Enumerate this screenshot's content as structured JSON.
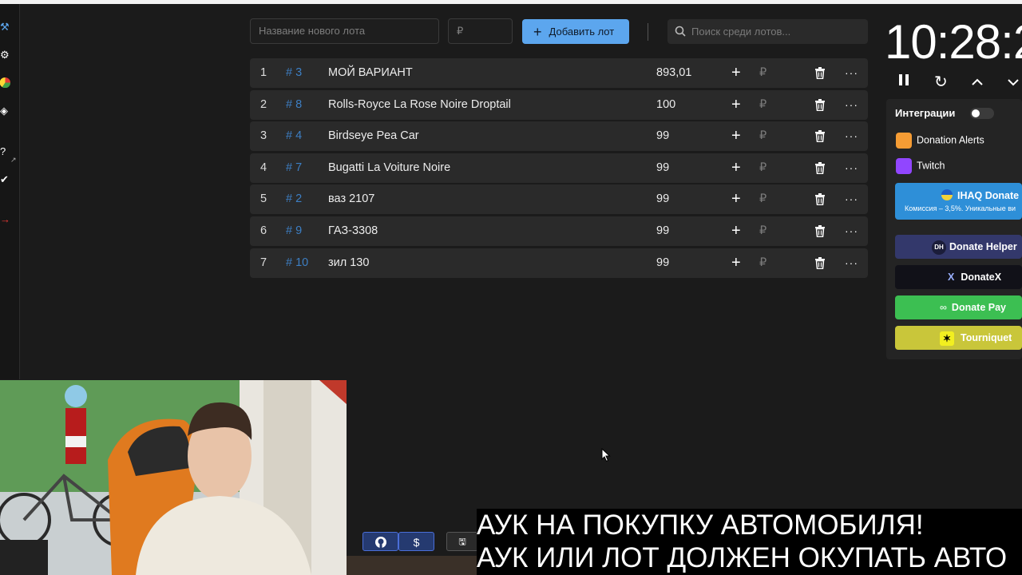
{
  "sidebar": {
    "icons": [
      "hammer-icon",
      "gear-icon",
      "pie-chart-icon",
      "layers-icon",
      "help-icon",
      "shield-check-icon",
      "logout-icon"
    ]
  },
  "toolbar": {
    "lot_name_placeholder": "Название нового лота",
    "amount_placeholder": "₽",
    "add_label": "Добавить лот",
    "search_placeholder": "Поиск среди лотов..."
  },
  "lots": [
    {
      "num": "1",
      "id": "# 3",
      "name": "МОЙ ВАРИАНТ",
      "amount": "893,01",
      "currency": "₽"
    },
    {
      "num": "2",
      "id": "# 8",
      "name": "Rolls-Royce La Rose Noire Droptail",
      "amount": "100",
      "currency": "₽"
    },
    {
      "num": "3",
      "id": "# 4",
      "name": "Birdseye Pea Car",
      "amount": "99",
      "currency": "₽"
    },
    {
      "num": "4",
      "id": "# 7",
      "name": "Bugatti La Voiture Noire",
      "amount": "99",
      "currency": "₽"
    },
    {
      "num": "5",
      "id": "# 2",
      "name": "ваз 2107",
      "amount": "99",
      "currency": "₽"
    },
    {
      "num": "6",
      "id": "# 9",
      "name": "ГАЗ-3308",
      "amount": "99",
      "currency": "₽"
    },
    {
      "num": "7",
      "id": "# 10",
      "name": "зил 130",
      "amount": "99",
      "currency": "₽"
    }
  ],
  "timer": {
    "display": "10:28:2"
  },
  "integrations": {
    "title": "Интеграции",
    "enabled": false,
    "items": [
      {
        "label": "Donation Alerts",
        "color": "#f59c34"
      },
      {
        "label": "Twitch",
        "color": "#9146ff"
      }
    ],
    "services": [
      {
        "label": "IHAQ Donate",
        "sub": "Комиссия – 3,5%. Уникальные ви",
        "color": "#2e8fd8"
      },
      {
        "label": "Donate Helper",
        "badge": "DH",
        "color": "#33386b"
      },
      {
        "label": "DonateX",
        "badge": "X",
        "color": "#111118"
      },
      {
        "label": "Donate Pay",
        "color": "#3cbf52"
      },
      {
        "label": "Tourniquet",
        "color": "#c9c63a"
      }
    ]
  },
  "bottom_buttons": {
    "github_icon": "github-icon",
    "donate_label": "$",
    "save_icon": "save-icon"
  },
  "ticker": {
    "line1": "АУК НА ПОКУПКУ АВТОМОБИЛЯ!",
    "line2": "АУК ИЛИ ЛОТ ДОЛЖЕН ОКУПАТЬ АВТО"
  }
}
